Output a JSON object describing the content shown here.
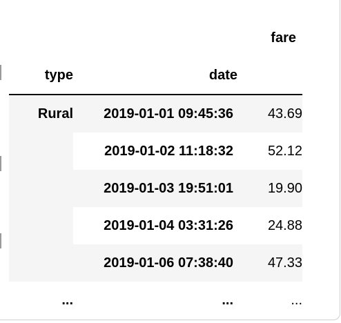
{
  "table": {
    "column_header": "fare",
    "index_names": {
      "level0": "type",
      "level1": "date"
    },
    "group_label": "Rural",
    "rows": [
      {
        "date": "2019-01-01 09:45:36",
        "fare": "43.69"
      },
      {
        "date": "2019-01-02 11:18:32",
        "fare": "52.12"
      },
      {
        "date": "2019-01-03 19:51:01",
        "fare": "19.90"
      },
      {
        "date": "2019-01-04 03:31:26",
        "fare": "24.88"
      },
      {
        "date": "2019-01-06 07:38:40",
        "fare": "47.33"
      }
    ],
    "ellipsis": {
      "type": "...",
      "date": "...",
      "fare": "..."
    }
  }
}
